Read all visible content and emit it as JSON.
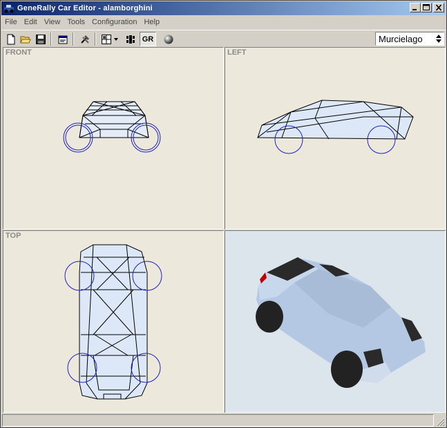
{
  "window": {
    "title": "GeneRally Car Editor - alamborghini"
  },
  "menu": {
    "items": [
      "File",
      "Edit",
      "View",
      "Tools",
      "Configuration",
      "Help"
    ]
  },
  "toolbar": {
    "gr_label": "GR",
    "car_select": {
      "value": "Murcielago"
    }
  },
  "viewports": {
    "front": "FRONT",
    "left": "LEFT",
    "top": "TOP"
  },
  "colors": {
    "wheel_outline": "#2020c0",
    "wireframe": "#000000",
    "body_fill": "#dce8f8",
    "shaded_body": "#b4c8e4",
    "window_dark": "#2a2a2a",
    "tire": "#222222",
    "light_red": "#c00000"
  }
}
